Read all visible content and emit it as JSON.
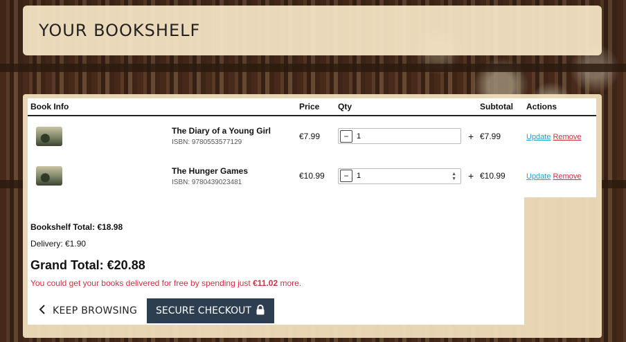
{
  "header": {
    "title": "YOUR BOOKSHELF"
  },
  "table": {
    "columns": [
      "Book Info",
      "Price",
      "Qty",
      "Subtotal",
      "Actions"
    ],
    "rows": [
      {
        "title": "The Diary of a Young Girl",
        "isbn": "ISBN: 9780553577129",
        "price": "€7.99",
        "qty": "1",
        "subtotal": "€7.99",
        "update": "Update",
        "remove": "Remove"
      },
      {
        "title": "The Hunger Games",
        "isbn": "ISBN: 9780439023481",
        "price": "€10.99",
        "qty": "1",
        "subtotal": "€10.99",
        "update": "Update",
        "remove": "Remove"
      }
    ],
    "minus_symbol": "−",
    "plus_symbol": "+"
  },
  "summary": {
    "bookshelf_total": "Bookshelf Total: €18.98",
    "delivery": "Delivery: €1.90",
    "grand_total": "Grand Total: €20.88",
    "free_prefix": "You could get your books delivered for free by spending just ",
    "free_amount": "€11.02",
    "free_suffix": " more."
  },
  "buttons": {
    "keep_browsing": "KEEP BROWSING",
    "keep_browsing_icon": "chevron-left-icon",
    "checkout": "SECURE CHECKOUT",
    "checkout_icon": "lock-icon"
  }
}
